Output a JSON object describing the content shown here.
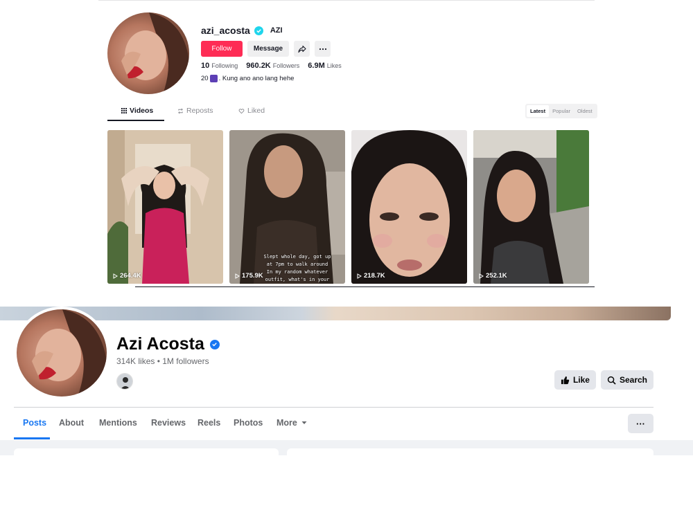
{
  "tiktok": {
    "username": "azi_acosta",
    "nickname": "AZI",
    "follow_label": "Follow",
    "message_label": "Message",
    "share_icon": "share-icon",
    "more_icon": "more-icon",
    "stats": {
      "following_count": "10",
      "following_label": "Following",
      "followers_count": "960.2K",
      "followers_label": "Followers",
      "likes_count": "6.9M",
      "likes_label": "Likes"
    },
    "bio_prefix": "20",
    "bio_text": ". Kung ano ano lang hehe",
    "tabs": [
      "Videos",
      "Reposts",
      "Liked"
    ],
    "sort": [
      "Latest",
      "Popular",
      "Oldest"
    ],
    "videos": [
      {
        "views": "264.4K",
        "caption": ""
      },
      {
        "views": "175.9K",
        "caption": "Slept whole day, got up at 7pm to walk around In my random whatever outfit, what's in your"
      },
      {
        "views": "218.7K",
        "caption": ""
      },
      {
        "views": "252.1K",
        "caption": ""
      }
    ],
    "accent": "#fe2c55"
  },
  "facebook": {
    "name": "Azi Acosta",
    "meta": "314K likes • 1M followers",
    "like_label": "Like",
    "search_label": "Search",
    "more_label": "···",
    "tabs": [
      "Posts",
      "About",
      "Mentions",
      "Reviews",
      "Reels",
      "Photos",
      "More"
    ],
    "accent": "#1877f2"
  }
}
